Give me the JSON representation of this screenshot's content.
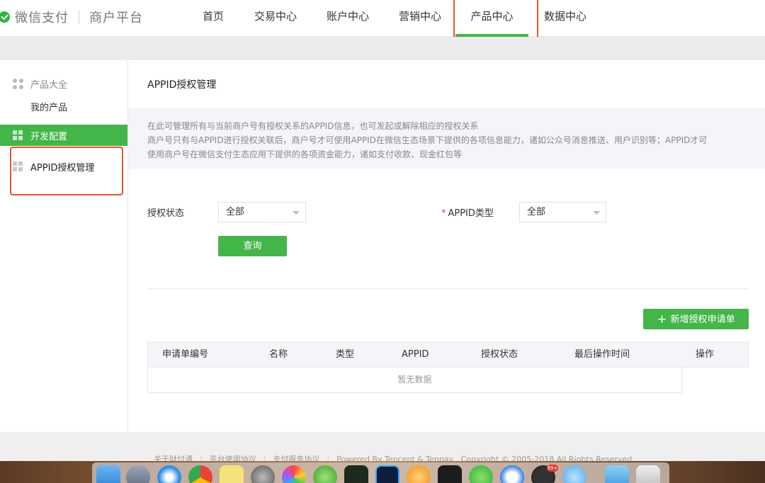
{
  "header": {
    "brand": "微信支付",
    "brand_sub": "商户平台",
    "nav": [
      {
        "label": "首页"
      },
      {
        "label": "交易中心"
      },
      {
        "label": "账户中心"
      },
      {
        "label": "营销中心"
      },
      {
        "label": "产品中心",
        "active": true
      },
      {
        "label": "数据中心"
      }
    ]
  },
  "sidebar": {
    "group_label": "产品大全",
    "group_sub": "我的产品",
    "active_label": "开发配置",
    "item_label": "APPID授权管理"
  },
  "main": {
    "title": "APPID授权管理",
    "notice_line1": "在此可管理所有与当前商户号有授权关系的APPID信息，也可发起或解除相应的授权关系",
    "notice_line2": "商户号只有与APPID进行授权关联后，商户号才可使用APPID在微信生态场景下提供的各项信息能力，诸如公众号消息推送、用户识别等；APPID才可",
    "notice_line3": "使用商户号在微信支付生态应用下提供的各项资金能力，诸如支付收款、现金红包等",
    "filter": {
      "status_label": "授权状态",
      "status_value": "全部",
      "type_required": "*",
      "type_label": "APPID类型",
      "type_value": "全部",
      "query_button": "查询"
    },
    "add_button": "新增授权申请单",
    "add_icon": "plus-icon",
    "table": {
      "columns": [
        "申请单编号",
        "名称",
        "类型",
        "APPID",
        "授权状态",
        "最后操作时间",
        "操作"
      ],
      "empty_text": "暂无数据"
    }
  },
  "footer": {
    "links": [
      "关于财付通",
      "平台使用协议",
      "支付服务协议"
    ],
    "powered": "Powered By Tencent & Tenpay",
    "copyright": "Copyright © 2005-2018 All Rights Reserved."
  },
  "dock": {
    "badge": "99+"
  },
  "colors": {
    "brand_green": "#44b549",
    "highlight_red": "#e4542e"
  }
}
